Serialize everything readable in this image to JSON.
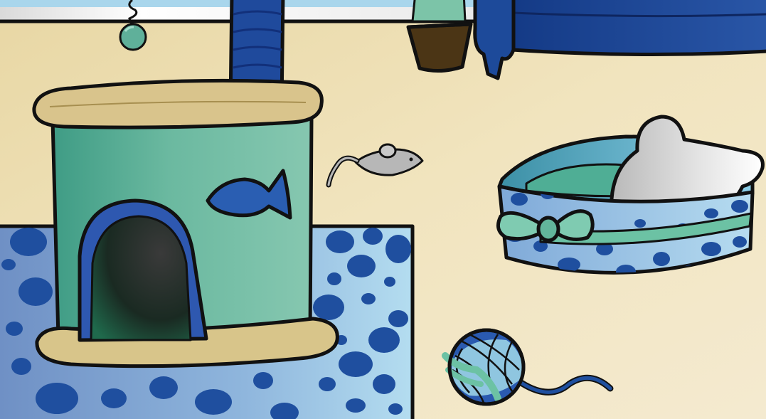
{
  "scene": {
    "colors": {
      "wall": "#efe2b8",
      "wall_shade": "#e6d3a0",
      "navy": "#1d3f8c",
      "navy_dark": "#143070",
      "teal": "#6cb8a0",
      "teal_light": "#86c9b3",
      "sky": "#a9d6ec",
      "sisal": "#d8c58a",
      "mouse_gray": "#b8b8b8",
      "pillow": "#e9e9e9",
      "ink": "#111111"
    },
    "icons": {
      "cat_tower": "cat-tower-icon",
      "fish_decal": "fish-icon",
      "toy_mouse": "mouse-toy-icon",
      "cat_bed": "cat-bed-icon",
      "yarn_ball": "yarn-ball-icon",
      "potted_plant": "plant-pot-icon",
      "dangling_toy": "hanging-toy-icon",
      "rug": "polka-dot-rug-icon",
      "curtain": "curtain-icon"
    }
  }
}
